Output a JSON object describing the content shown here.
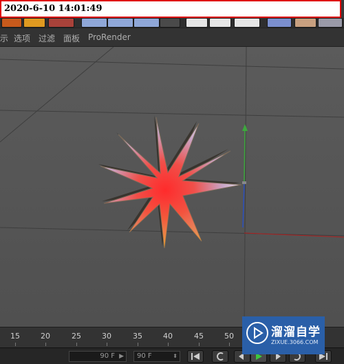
{
  "timestamp": "2020-6-10 14:01:49",
  "menubar": {
    "items": [
      "示",
      "选项",
      "过滤",
      "面板",
      "ProRender"
    ]
  },
  "timeline": {
    "ticks": [
      "15",
      "20",
      "25",
      "30",
      "35",
      "40",
      "45",
      "50"
    ]
  },
  "transport": {
    "min_field": "90 F",
    "max_field": "90 F"
  },
  "watermark": {
    "title": "溜溜自学",
    "url": "ZIXUE.3066.COM"
  },
  "colors": {
    "timestamp_border": "#e00000",
    "watermark_bg": "#2a5fa8",
    "axis_y": "#3ea83e",
    "axis_x": "#b02020",
    "axis_z": "#2a4fbf"
  }
}
